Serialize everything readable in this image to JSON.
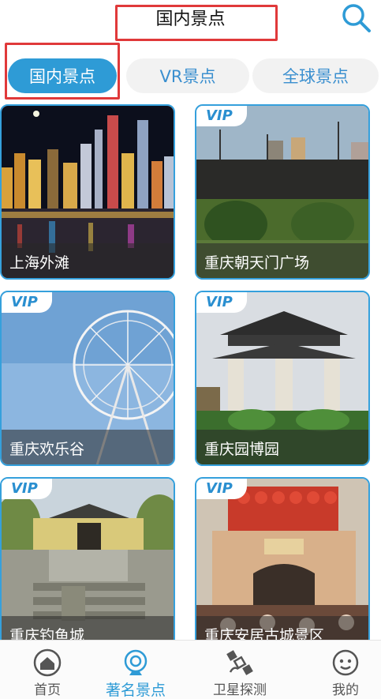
{
  "header": {
    "title": "国内景点"
  },
  "tabs": [
    {
      "label": "国内景点",
      "active": true
    },
    {
      "label": "VR景点",
      "active": false
    },
    {
      "label": "全球景点",
      "active": false
    }
  ],
  "vip_label": "VIP",
  "cards": [
    {
      "name": "上海外滩",
      "vip": false
    },
    {
      "name": "重庆朝天门广场",
      "vip": true
    },
    {
      "name": "重庆欢乐谷",
      "vip": true
    },
    {
      "name": "重庆园博园",
      "vip": true
    },
    {
      "name": "重庆钓鱼城",
      "vip": true
    },
    {
      "name": "重庆安居古城景区",
      "vip": true
    }
  ],
  "bottom_nav": [
    {
      "label": "首页",
      "icon": "home-icon"
    },
    {
      "label": "著名景点",
      "icon": "camera-icon",
      "active": true
    },
    {
      "label": "卫星探测",
      "icon": "satellite-icon"
    },
    {
      "label": "我的",
      "icon": "profile-face-icon"
    }
  ],
  "colors": {
    "accent": "#2e9bd6",
    "highlight_box": "#e0393a"
  }
}
